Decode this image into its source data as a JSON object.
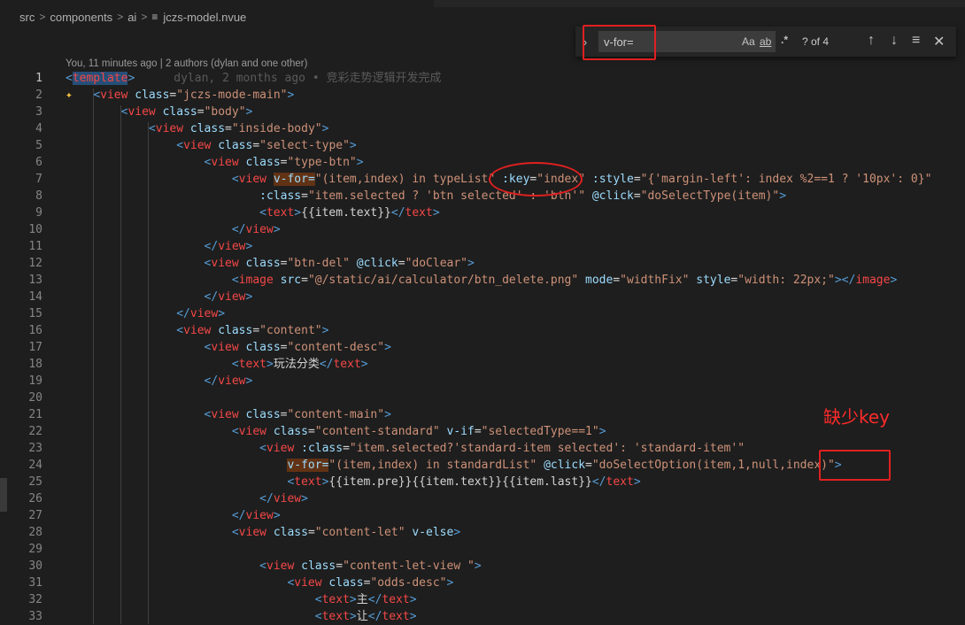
{
  "breadcrumb": {
    "parts": [
      "src",
      "components",
      "ai"
    ],
    "file": "jczs-model.nvue"
  },
  "codelens": "You, 11 minutes ago | 2 authors (dylan and one other)",
  "find": {
    "query": "v-for=",
    "opt_case": "Aa",
    "opt_word": "ab",
    "opt_regex": ".*",
    "count": "? of 4"
  },
  "annotation": "缺少key",
  "lines": [
    {
      "n": "1",
      "html": "<span class='tg'>&lt;</span><span class='tn' style='background:#264f78'>template</span><span class='tg'>&gt;</span><span class='blame'>dylan, 2 months ago • 竞彩走势逻辑开发完成</span>"
    },
    {
      "n": "2",
      "html": "    <span class='tg'>&lt;</span><span class='tn'>view</span> <span class='at'>class</span><span class='tx'>=</span><span class='st'>\"jczs-mode-main\"</span><span class='tg'>&gt;</span>"
    },
    {
      "n": "3",
      "html": "        <span class='tg'>&lt;</span><span class='tn'>view</span> <span class='at'>class</span><span class='tx'>=</span><span class='st'>\"body\"</span><span class='tg'>&gt;</span>"
    },
    {
      "n": "4",
      "html": "            <span class='tg'>&lt;</span><span class='tn'>view</span> <span class='at'>class</span><span class='tx'>=</span><span class='st'>\"inside-body\"</span><span class='tg'>&gt;</span>"
    },
    {
      "n": "5",
      "html": "                <span class='tg'>&lt;</span><span class='tn'>view</span> <span class='at'>class</span><span class='tx'>=</span><span class='st'>\"select-type\"</span><span class='tg'>&gt;</span>"
    },
    {
      "n": "6",
      "html": "                    <span class='tg'>&lt;</span><span class='tn'>view</span> <span class='at'>class</span><span class='tx'>=</span><span class='st'>\"type-btn\"</span><span class='tg'>&gt;</span>"
    },
    {
      "n": "7",
      "html": "                        <span class='tg'>&lt;</span><span class='tn'>view</span> <span class='at hl'>v-for=</span><span class='st'>\"(item,index) in typeList\"</span> <span class='at'>:key</span><span class='tx'>=</span><span class='st'>\"index\"</span> <span class='at'>:style</span><span class='tx'>=</span><span class='st'>\"{'margin-left': index %2==1 ? '10px': 0}\"</span>"
    },
    {
      "n": "8",
      "html": "                            <span class='at'>:class</span><span class='tx'>=</span><span class='st'>\"item.selected ? 'btn selected' : 'btn'\"</span> <span class='at'>@click</span><span class='tx'>=</span><span class='st'>\"doSelectType(item)\"</span><span class='tg'>&gt;</span>"
    },
    {
      "n": "9",
      "html": "                            <span class='tg'>&lt;</span><span class='tn'>text</span><span class='tg'>&gt;</span><span class='tx'>{{item.text}}</span><span class='tg'>&lt;/</span><span class='tn'>text</span><span class='tg'>&gt;</span>"
    },
    {
      "n": "10",
      "html": "                        <span class='tg'>&lt;/</span><span class='tn'>view</span><span class='tg'>&gt;</span>"
    },
    {
      "n": "11",
      "html": "                    <span class='tg'>&lt;/</span><span class='tn'>view</span><span class='tg'>&gt;</span>"
    },
    {
      "n": "12",
      "html": "                    <span class='tg'>&lt;</span><span class='tn'>view</span> <span class='at'>class</span><span class='tx'>=</span><span class='st'>\"btn-del\"</span> <span class='at'>@click</span><span class='tx'>=</span><span class='st'>\"doClear\"</span><span class='tg'>&gt;</span>"
    },
    {
      "n": "13",
      "html": "                        <span class='tg'>&lt;</span><span class='tn'>image</span> <span class='at'>src</span><span class='tx'>=</span><span class='st'>\"@/static/ai/calculator/btn_delete.png\"</span> <span class='at'>mode</span><span class='tx'>=</span><span class='st'>\"widthFix\"</span> <span class='at'>style</span><span class='tx'>=</span><span class='st'>\"width: 22px;\"</span><span class='tg'>&gt;&lt;/</span><span class='tn'>image</span><span class='tg'>&gt;</span>"
    },
    {
      "n": "14",
      "html": "                    <span class='tg'>&lt;/</span><span class='tn'>view</span><span class='tg'>&gt;</span>"
    },
    {
      "n": "15",
      "html": "                <span class='tg'>&lt;/</span><span class='tn'>view</span><span class='tg'>&gt;</span>"
    },
    {
      "n": "16",
      "html": "                <span class='tg'>&lt;</span><span class='tn'>view</span> <span class='at'>class</span><span class='tx'>=</span><span class='st'>\"content\"</span><span class='tg'>&gt;</span>"
    },
    {
      "n": "17",
      "html": "                    <span class='tg'>&lt;</span><span class='tn'>view</span> <span class='at'>class</span><span class='tx'>=</span><span class='st'>\"content-desc\"</span><span class='tg'>&gt;</span>"
    },
    {
      "n": "18",
      "html": "                        <span class='tg'>&lt;</span><span class='tn'>text</span><span class='tg'>&gt;</span><span class='tx'>玩法分类</span><span class='tg'>&lt;/</span><span class='tn'>text</span><span class='tg'>&gt;</span>"
    },
    {
      "n": "19",
      "html": "                    <span class='tg'>&lt;/</span><span class='tn'>view</span><span class='tg'>&gt;</span>"
    },
    {
      "n": "20",
      "html": ""
    },
    {
      "n": "21",
      "html": "                    <span class='tg'>&lt;</span><span class='tn'>view</span> <span class='at'>class</span><span class='tx'>=</span><span class='st'>\"content-main\"</span><span class='tg'>&gt;</span>"
    },
    {
      "n": "22",
      "html": "                        <span class='tg'>&lt;</span><span class='tn'>view</span> <span class='at'>class</span><span class='tx'>=</span><span class='st'>\"content-standard\"</span> <span class='at'>v-if</span><span class='tx'>=</span><span class='st'>\"selectedType==1\"</span><span class='tg'>&gt;</span>"
    },
    {
      "n": "23",
      "html": "                            <span class='tg'>&lt;</span><span class='tn'>view</span> <span class='at'>:class</span><span class='tx'>=</span><span class='st'>\"item.selected?'standard-item selected': 'standard-item'\"</span>"
    },
    {
      "n": "24",
      "html": "                                <span class='at hl'>v-for=</span><span class='st'>\"(item,index) in standardList\"</span> <span class='at'>@click</span><span class='tx'>=</span><span class='st'>\"doSelectOption(item,1,null,index)\"</span><span class='tg'>&gt;</span>"
    },
    {
      "n": "25",
      "html": "                                <span class='tg'>&lt;</span><span class='tn'>text</span><span class='tg'>&gt;</span><span class='tx'>{{item.pre}}{{item.text}}{{item.last}}</span><span class='tg'>&lt;/</span><span class='tn'>text</span><span class='tg'>&gt;</span>"
    },
    {
      "n": "26",
      "html": "                            <span class='tg'>&lt;/</span><span class='tn'>view</span><span class='tg'>&gt;</span>"
    },
    {
      "n": "27",
      "html": "                        <span class='tg'>&lt;/</span><span class='tn'>view</span><span class='tg'>&gt;</span>"
    },
    {
      "n": "28",
      "html": "                        <span class='tg'>&lt;</span><span class='tn'>view</span> <span class='at'>class</span><span class='tx'>=</span><span class='st'>\"content-let\"</span> <span class='at'>v-else</span><span class='tg'>&gt;</span>"
    },
    {
      "n": "29",
      "html": ""
    },
    {
      "n": "30",
      "html": "                            <span class='tg'>&lt;</span><span class='tn'>view</span> <span class='at'>class</span><span class='tx'>=</span><span class='st'>\"content-let-view \"</span><span class='tg'>&gt;</span>"
    },
    {
      "n": "31",
      "html": "                                <span class='tg'>&lt;</span><span class='tn'>view</span> <span class='at'>class</span><span class='tx'>=</span><span class='st'>\"odds-desc\"</span><span class='tg'>&gt;</span>"
    },
    {
      "n": "32",
      "html": "                                    <span class='tg'>&lt;</span><span class='tn'>text</span><span class='tg'>&gt;</span><span class='tx'>主</span><span class='tg'>&lt;/</span><span class='tn'>text</span><span class='tg'>&gt;</span>"
    },
    {
      "n": "33",
      "html": "                                    <span class='tg'>&lt;</span><span class='tn'>text</span><span class='tg'>&gt;</span><span class='tx'>让</span><span class='tg'>&lt;/</span><span class='tn'>text</span><span class='tg'>&gt;</span>"
    }
  ]
}
